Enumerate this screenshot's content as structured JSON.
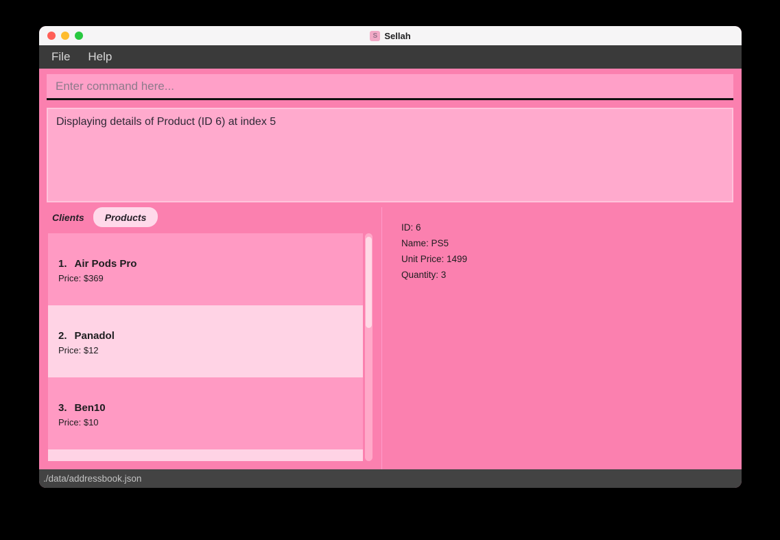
{
  "window": {
    "title": "Sellah",
    "icon_letter": "S"
  },
  "menu": {
    "items": [
      "File",
      "Help"
    ]
  },
  "command": {
    "placeholder": "Enter command here..."
  },
  "result": {
    "text": "Displaying details of Product (ID 6) at index 5"
  },
  "tabs": {
    "clients": "Clients",
    "products": "Products",
    "active": "Products"
  },
  "product_list": {
    "items": [
      {
        "index": "1.",
        "name": "Air Pods Pro",
        "price": "Price: $369"
      },
      {
        "index": "2.",
        "name": "Panadol",
        "price": "Price: $12"
      },
      {
        "index": "3.",
        "name": "Ben10",
        "price": "Price: $10"
      }
    ]
  },
  "detail": {
    "lines": [
      "ID: 6",
      "Name: PS5",
      "Unit Price: 1499",
      "Quantity: 3"
    ]
  },
  "statusbar": {
    "path": "./data/addressbook.json"
  },
  "colors": {
    "window_background": "#fb80af",
    "input_background": "#ffa0c8",
    "result_background": "#ffaacd",
    "row_odd": "#ff9ac3",
    "row_even": "#ffd3e5",
    "tab_active_background": "#ffd9ea",
    "scrollbar_thumb": "#ffd9e6",
    "titlebar_background": "#f6f5f6",
    "menubar_background": "#3a3a3a",
    "statusbar_background": "#434343",
    "traffic_red": "#ff5f57",
    "traffic_yellow": "#febc2e",
    "traffic_green": "#28c840"
  }
}
